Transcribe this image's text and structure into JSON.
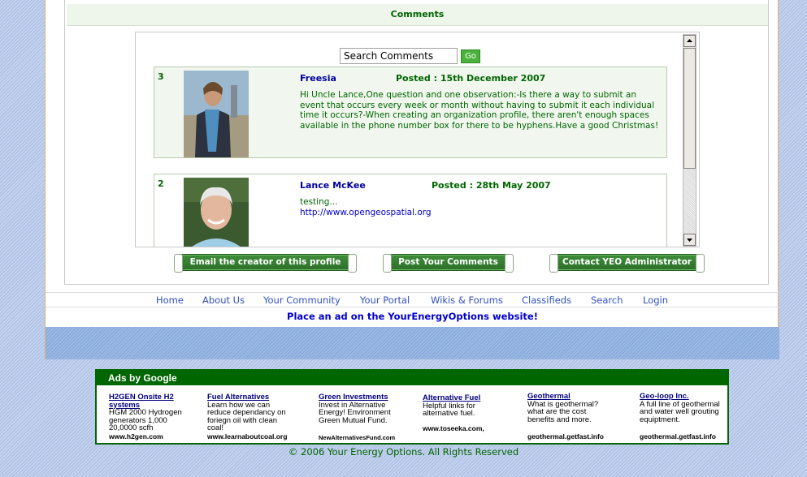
{
  "comments_section": {
    "header": "Comments",
    "search": {
      "value": "Search Comments",
      "button": "Go"
    },
    "items": [
      {
        "number": "3",
        "author": "Freesia",
        "posted": "Posted : 15th December 2007",
        "text": "Hi Uncle Lance,One question and one observation:-Is there a way to submit an event that occurs every week or month without having to submit it each individual time it occurs?-When creating an organization profile, there aren't enough spaces available in the phone number box for there to be hyphens.Have a good Christmas!",
        "link": ""
      },
      {
        "number": "2",
        "author": "Lance McKee",
        "posted": "Posted : 28th May 2007",
        "text": "testing...",
        "link": "http://www.opengeospatial.org"
      }
    ],
    "buttons": {
      "email": "Email the creator of this profile",
      "post": "Post Your Comments",
      "contact": "Contact YEO Administrator"
    }
  },
  "nav": [
    "Home",
    "About Us",
    "Your Community",
    "Your Portal",
    "Wikis & Forums",
    "Classifieds",
    "Search",
    "Login"
  ],
  "ad_link": "Place an ad on the YourEnergyOptions website!",
  "ads": {
    "header": "Ads by Google",
    "items": [
      {
        "title": "2GEN Onsite H2 systems",
        "title_lead": "H",
        "desc": "HGM 2000 Hydrogen generators 1,000 20,0000 scfh",
        "url": "www.h2gen.com"
      },
      {
        "title": "Fuel Alternatives",
        "desc": "Learn how we can reduce dependancy on foriegn oil with clean coal!",
        "url": "www.learnaboutcoal.org"
      },
      {
        "title": "Green Investments",
        "desc": "Invest in Alternative Energy! Environment Green Mutual Fund.",
        "url": "NewAlternativesFund.com"
      },
      {
        "title": "Alternative Fuel",
        "desc": "Helpful links for alternative fuel.",
        "url": "www.toseeka.com,"
      },
      {
        "title": "Geothermal",
        "desc": "What is geothermal? what are the cost benefits and more.",
        "url": "geothermal.getfast.info"
      },
      {
        "title": "Geo-loop Inc.",
        "desc": "A full line of geothermal and water well grouting equiptment.",
        "url": "geothermal.getfast.info"
      }
    ]
  },
  "copyright": "© 2006 Your Energy Options. All Rights Reserved",
  "colors": {
    "green": "#006600",
    "nav_blue": "#3050c0",
    "link_blue": "#0000cc",
    "band_blue": "#8fb0de"
  }
}
